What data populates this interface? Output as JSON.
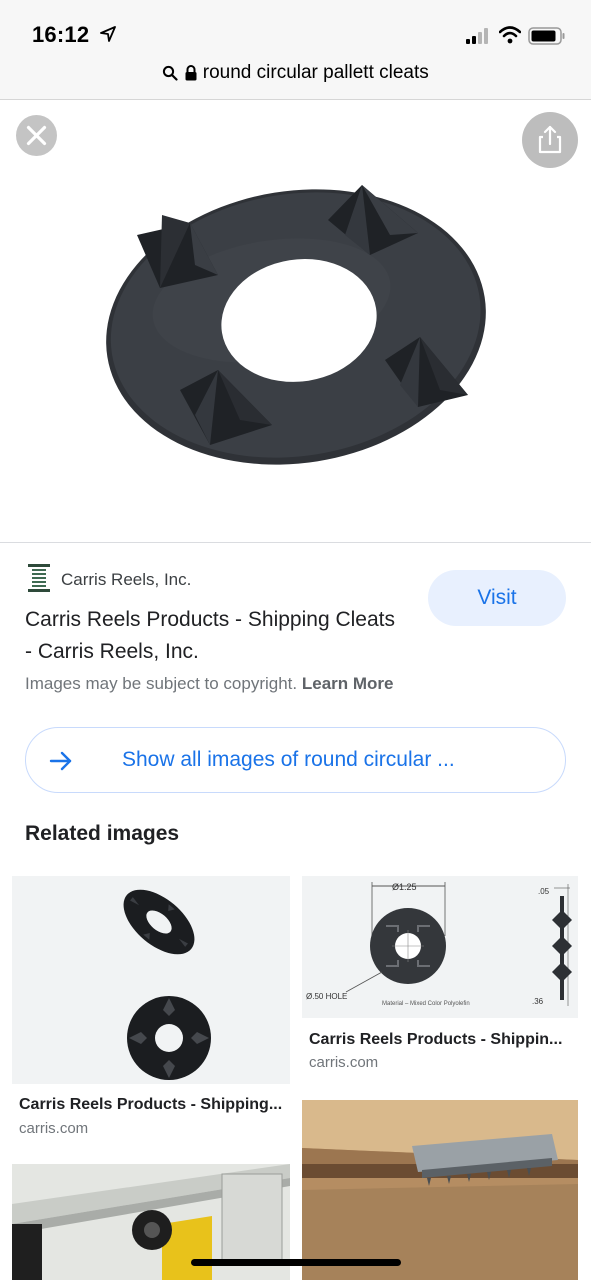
{
  "status_bar": {
    "time": "16:12"
  },
  "url_bar": {
    "url": "round circular pallett cleats"
  },
  "result": {
    "source_name": "Carris Reels, Inc.",
    "title": "Carris Reels Products - Shipping Cleats - Carris Reels, Inc.",
    "visit_label": "Visit",
    "copyright_text": "Images may be subject to copyright.",
    "learn_more": "Learn More"
  },
  "show_all": {
    "label": "Show all images of round circular ..."
  },
  "related": {
    "heading": "Related images",
    "items": [
      {
        "title": "Carris Reels Products - Shipping...",
        "source": "carris.com"
      },
      {
        "title": "Carris Reels Products - Shippin...",
        "source": "carris.com"
      }
    ],
    "diagram_labels": {
      "diameter": "Ø1.25",
      "height": ".05",
      "hole": "Ø.50 HOLE",
      "material": "Material – Mixed Color Polyolefin",
      "thickness": ".36"
    }
  },
  "colors": {
    "accent": "#1a73e8",
    "visit_bg": "#e8f0fe",
    "cleat": "#2f3237"
  }
}
